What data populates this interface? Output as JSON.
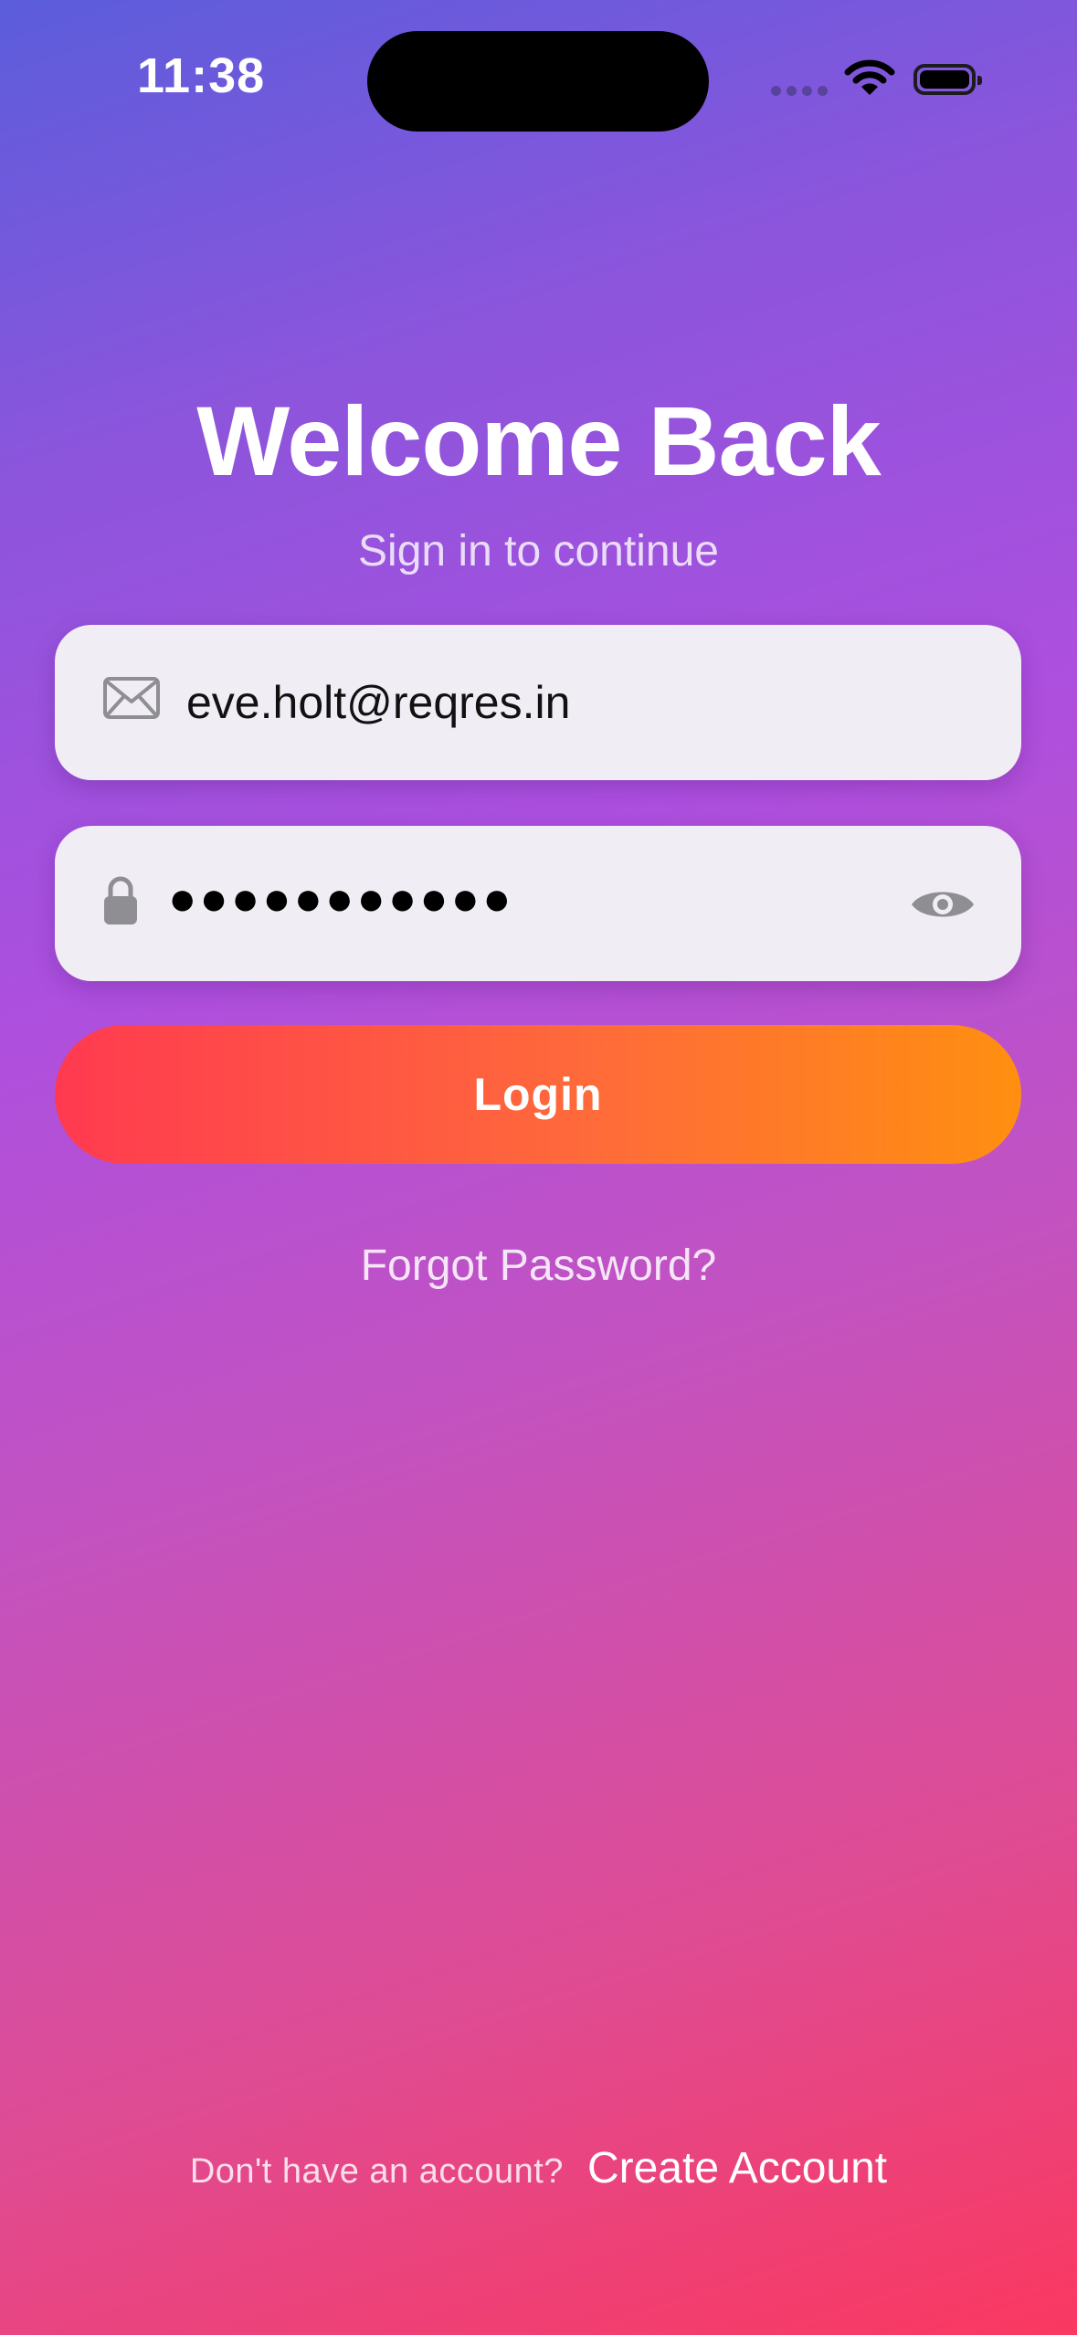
{
  "status_bar": {
    "time": "11:38",
    "icons": [
      "signal-icon",
      "wifi-icon",
      "battery-icon"
    ]
  },
  "header": {
    "title": "Welcome Back",
    "subtitle": "Sign in to continue"
  },
  "form": {
    "email": {
      "icon": "envelope-icon",
      "value": "eve.holt@reqres.in"
    },
    "password": {
      "icon": "lock-icon",
      "masked_value": "●●●●●●●●●●●",
      "toggle_icon": "eye-icon"
    },
    "login_label": "Login",
    "forgot_label": "Forgot Password?"
  },
  "footer": {
    "prompt": "Don't have an account?",
    "create_label": "Create Account"
  },
  "colors": {
    "gradient_top": "#5b5ddb",
    "gradient_mid": "#ad4fdf",
    "gradient_bottom": "#fa3860",
    "button_start": "#ff3a50",
    "button_end": "#ff8f10",
    "field_bg": "#f1edf5"
  }
}
